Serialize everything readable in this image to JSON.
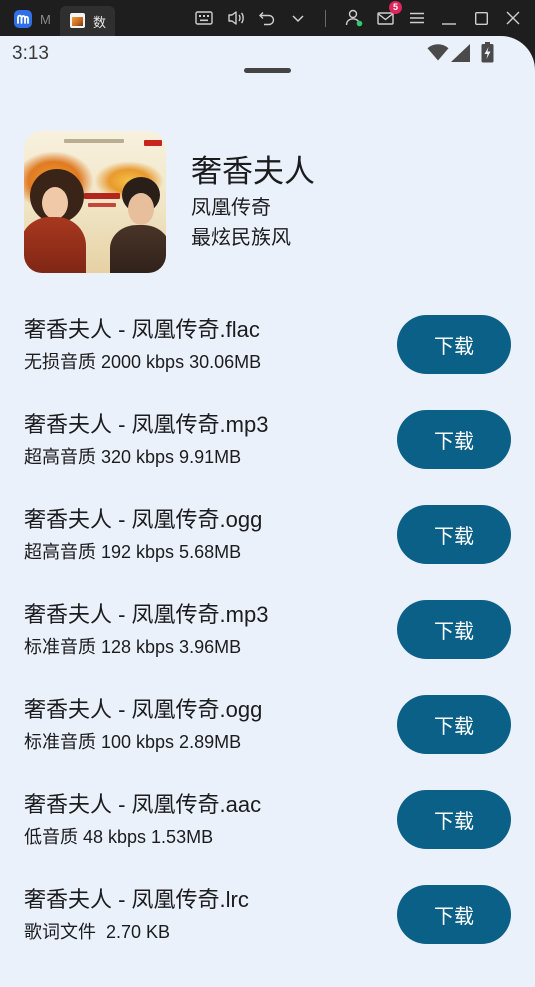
{
  "window": {
    "tab_label": "M",
    "active_tab_label": "数",
    "mail_badge_count": "5",
    "icons": [
      "app-logo-icon",
      "tab-favicon-icon",
      "keyboard-icon",
      "volume-icon",
      "undo-icon",
      "chevron-down-icon",
      "account-icon",
      "mail-icon",
      "menu-icon",
      "minimize-icon",
      "maximize-icon",
      "close-icon"
    ]
  },
  "status_bar": {
    "time": "3:13",
    "icons": [
      "wifi-icon",
      "cellular-signal-icon",
      "battery-charging-icon"
    ]
  },
  "song": {
    "title": "奢香夫人",
    "artist": "凤凰传奇",
    "album": "最炫民族风"
  },
  "download_label": "下载",
  "downloads": [
    {
      "name": "奢香夫人 - 凤凰传奇.flac",
      "detail": "无损音质 2000 kbps 30.06MB"
    },
    {
      "name": "奢香夫人 - 凤凰传奇.mp3",
      "detail": "超高音质 320 kbps 9.91MB"
    },
    {
      "name": "奢香夫人 - 凤凰传奇.ogg",
      "detail": "超高音质 192 kbps 5.68MB"
    },
    {
      "name": "奢香夫人 - 凤凰传奇.mp3",
      "detail": "标准音质 128 kbps 3.96MB"
    },
    {
      "name": "奢香夫人 - 凤凰传奇.ogg",
      "detail": "标准音质 100 kbps 2.89MB"
    },
    {
      "name": "奢香夫人 - 凤凰传奇.aac",
      "detail": "低音质 48 kbps 1.53MB"
    },
    {
      "name": "奢香夫人 - 凤凰传奇.lrc",
      "detail": "歌词文件  2.70 KB"
    }
  ],
  "colors": {
    "titlebar": "#1e1e1e",
    "screen_background": "#ebf1fa",
    "button": "#0b6088",
    "button_text": "#ffffff",
    "text": "#1b1c1e",
    "badge": "#e0245e",
    "app_logo": "#2f6fe8"
  }
}
